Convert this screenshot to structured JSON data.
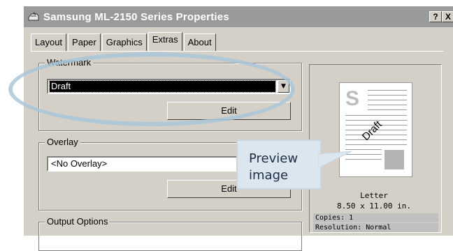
{
  "window": {
    "title": "Samsung ML-2150 Series Properties",
    "help_button": "?",
    "close_button": "X"
  },
  "tabs": [
    {
      "label": "Layout",
      "active": false
    },
    {
      "label": "Paper",
      "active": false
    },
    {
      "label": "Graphics",
      "active": false
    },
    {
      "label": "Extras",
      "active": true
    },
    {
      "label": "About",
      "active": false
    }
  ],
  "watermark": {
    "group_label": "Watermark",
    "selected": "Draft",
    "edit_button": "Edit"
  },
  "overlay": {
    "group_label": "Overlay",
    "selected": "<No Overlay>",
    "edit_button": "Edit"
  },
  "output_options": {
    "group_label": "Output Options"
  },
  "preview": {
    "page_letter": "S",
    "watermark_text": "Draft",
    "paper_name": "Letter",
    "paper_size": "8.50 x 11.00 in.",
    "copies": "Copies: 1",
    "resolution": "Resolution: Normal"
  },
  "callout": {
    "text": "Preview\nimage"
  },
  "colors": {
    "dialog_bg": "#d4d0c8",
    "titlebar_bg": "#9a9a9a",
    "highlight_ring": "#a9c5d8",
    "callout_bg": "#dce6ee"
  }
}
